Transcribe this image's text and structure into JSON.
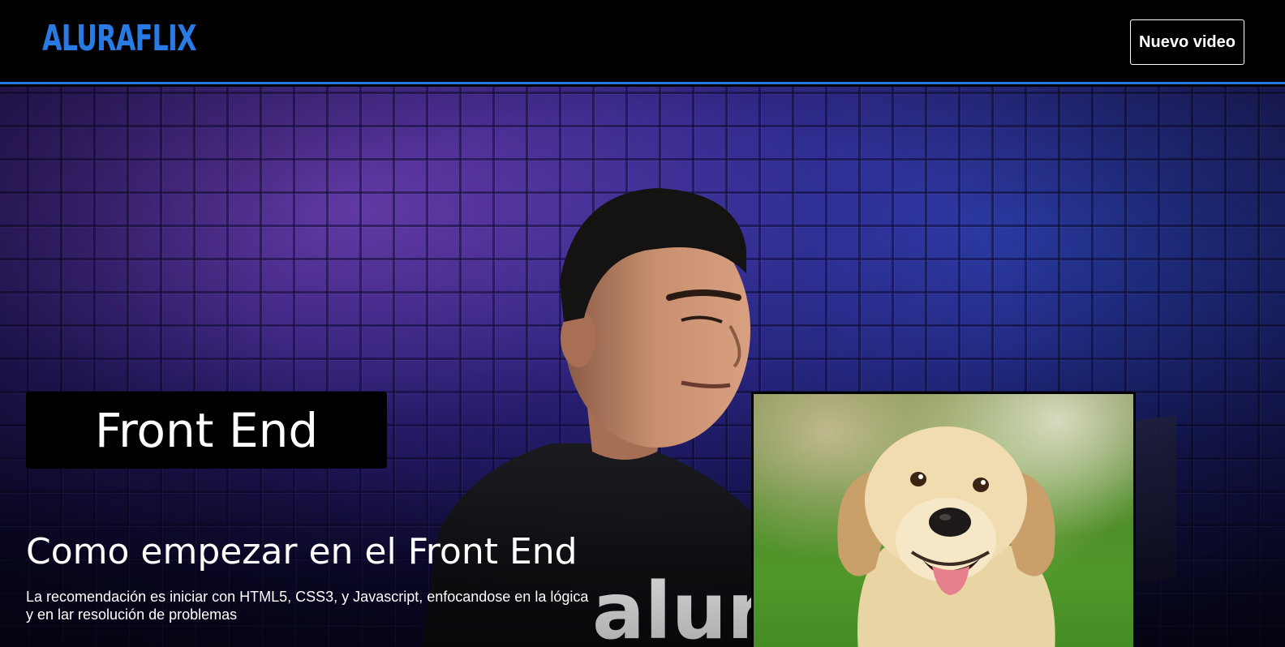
{
  "header": {
    "logo_text": "ALURAFLIX",
    "new_video_label": "Nuevo video"
  },
  "hero": {
    "category": "Front End",
    "title": "Como empezar en el Front End",
    "description_line1": "La recomendación es iniciar con HTML5, CSS3, y Javascript, enfocandose en la lógica",
    "description_line2": "y en lar resolución de problemas",
    "shirt_text": "alura"
  },
  "colors": {
    "brand": "#2a7ae4",
    "header_bg": "#000000",
    "badge_bg": "#000000"
  },
  "icons": {
    "thumbnail": "golden-retriever-dog-image"
  }
}
